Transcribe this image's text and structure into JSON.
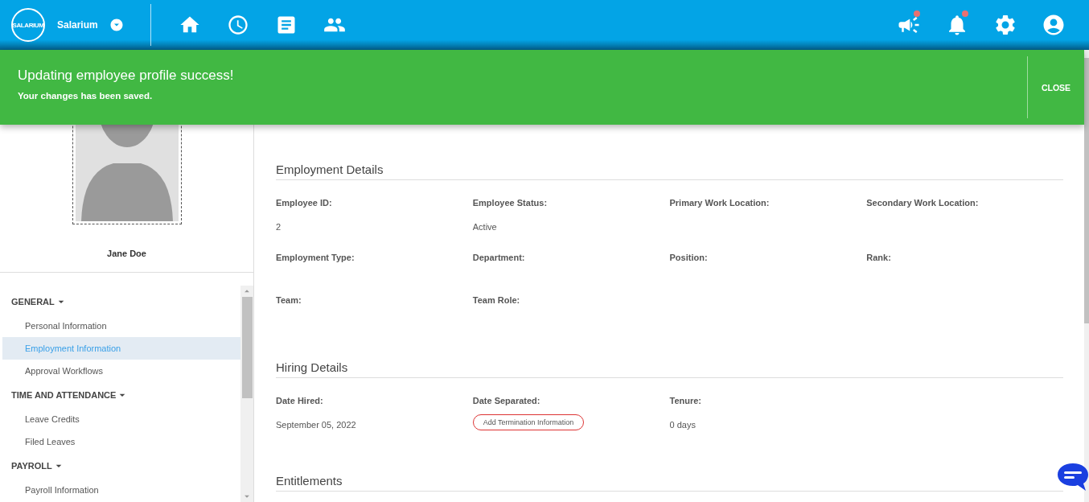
{
  "header": {
    "logo_text": "SALARIUM",
    "company": "Salarium",
    "nav": [
      {
        "kind": "home"
      },
      {
        "kind": "clock"
      },
      {
        "kind": "document"
      },
      {
        "kind": "people"
      }
    ],
    "actions": [
      {
        "kind": "megaphone",
        "unread": true
      },
      {
        "kind": "bell",
        "unread": true
      },
      {
        "kind": "settings"
      },
      {
        "kind": "account"
      }
    ]
  },
  "toast": {
    "title": "Updating employee profile success!",
    "message": "Your changes has been saved.",
    "close": "CLOSE"
  },
  "profile": {
    "name": "Jane Doe"
  },
  "sidebar": {
    "groups": [
      {
        "label": "GENERAL",
        "expanded": true,
        "children": [
          {
            "label": "Personal Information",
            "selected": false
          },
          {
            "label": "Employment Information",
            "selected": true
          },
          {
            "label": "Approval Workflows",
            "selected": false
          }
        ]
      },
      {
        "label": "TIME AND ATTENDANCE",
        "expanded": true,
        "children": [
          {
            "label": "Leave Credits",
            "selected": false
          },
          {
            "label": "Filed Leaves",
            "selected": false
          }
        ]
      },
      {
        "label": "PAYROLL",
        "expanded": true,
        "children": [
          {
            "label": "Payroll Information",
            "selected": false
          }
        ]
      }
    ]
  },
  "sections": [
    {
      "title": "Employment Details",
      "fields": [
        {
          "label": "Employee ID:",
          "value": "2"
        },
        {
          "label": "Employee Status:",
          "value": "Active"
        },
        {
          "label": "Primary Work Location:"
        },
        {
          "label": "Secondary Work Location:"
        },
        {
          "label": "Employment Type:"
        },
        {
          "label": "Department:"
        },
        {
          "label": "Position:"
        },
        {
          "label": "Rank:"
        },
        {
          "label": "Team:"
        },
        {
          "label": "Team Role:"
        }
      ]
    },
    {
      "title": "Hiring Details",
      "fields": [
        {
          "label": "Date Hired:",
          "value": "September 05, 2022"
        },
        {
          "label": "Date Separated:",
          "action": "Add Termination Information"
        },
        {
          "label": "Tenure:",
          "value": "0 days"
        }
      ]
    },
    {
      "title": "Entitlements"
    }
  ]
}
